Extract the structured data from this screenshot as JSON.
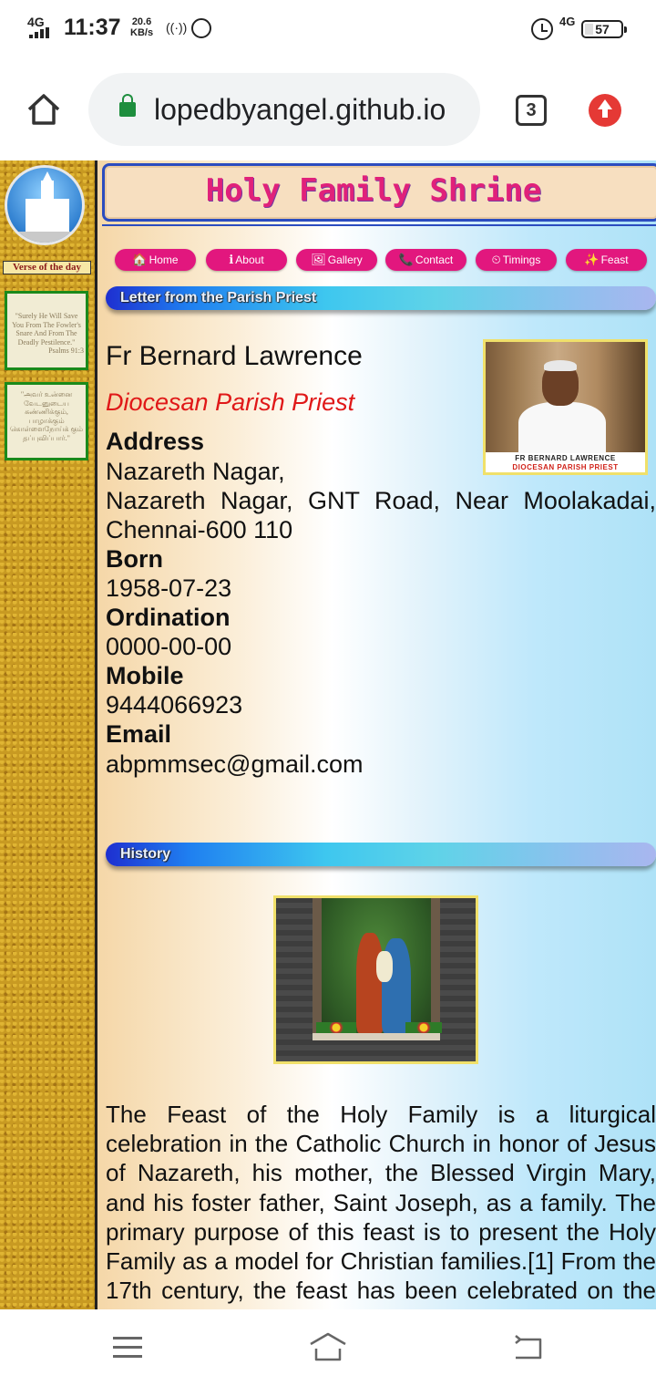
{
  "status_bar": {
    "network": "4G",
    "time": "11:37",
    "speed_value": "20.6",
    "speed_unit": "KB/s",
    "network_right": "4G",
    "battery": "57"
  },
  "browser": {
    "url": "lopedbyangel.github.io",
    "tab_count": "3"
  },
  "sidebar": {
    "verse_title": "Verse of the day",
    "verse_en": "\"Surely He Will Save You From The Fowler's Snare And From The Deadly Pestilence.\"",
    "verse_en_ref": "Psalms 91:3",
    "verse_ta": "\"அவர் உன்னை வேடனுடைய கண்ணிக்கும், பாழாக்கும் கொள்ளைநோய்க் கும் தப்புவிப்பார்.\""
  },
  "header": {
    "title": "Holy Family Shrine"
  },
  "nav": [
    {
      "label": "Home",
      "icon": "🏠"
    },
    {
      "label": "About",
      "icon": "ℹ"
    },
    {
      "label": "Gallery",
      "icon": "🖼"
    },
    {
      "label": "Contact",
      "icon": "📞"
    },
    {
      "label": "Timings",
      "icon": "⏲"
    },
    {
      "label": "Feast",
      "icon": "✨"
    }
  ],
  "letter_section": {
    "heading": "Letter from the Parish Priest",
    "name": "Fr Bernard Lawrence",
    "role": "Diocesan Parish Priest",
    "photo_caption_name": "FR BERNARD LAWRENCE",
    "photo_caption_role": "DIOCESAN PARISH PRIEST",
    "address_label": "Address",
    "address_line1": "Nazareth Nagar,",
    "address_line2": "Nazareth Nagar, GNT Road, Near Moolakadai,",
    "address_line3": "Chennai-600 110",
    "born_label": "Born",
    "born": "1958-07-23",
    "ordination_label": "Ordination",
    "ordination": "0000-00-00",
    "mobile_label": "Mobile",
    "mobile": "9444066923",
    "email_label": "Email",
    "email": "abpmmsec@gmail.com"
  },
  "history_section": {
    "heading": "History",
    "text": "The Feast of the Holy Family is a liturgical celebration in the Catholic Church in honor of Jesus of Nazareth, his mother, the Blessed Virgin Mary, and his foster father, Saint Joseph, as a family. The primary purpose of this feast is to present the Holy Family as a model for Christian families.[1] From the 17th century, the feast has been celebrated on the Sunday between the octave of Christmas"
  },
  "colors": {
    "accent_pink": "#e2177e",
    "header_title": "#e0217a",
    "header_border": "#2b4cbf",
    "role_red": "#e01818",
    "sidebar_gold": "#c89a22"
  }
}
